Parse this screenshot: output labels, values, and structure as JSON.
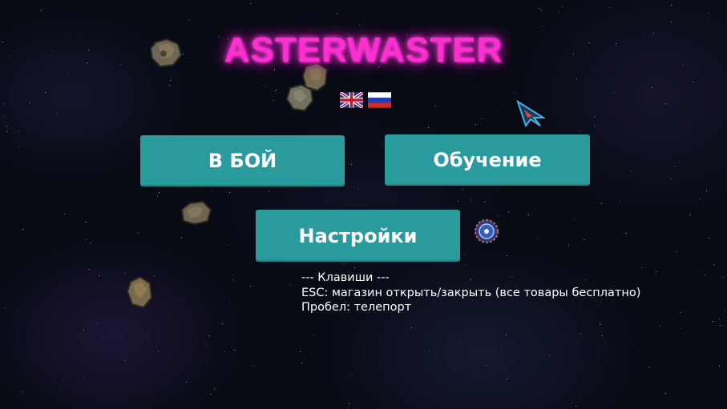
{
  "game": {
    "title": "ASTERWASTER",
    "title_color": "#ff2fcf",
    "button_color": "#2a9b9c"
  },
  "language_flags": [
    {
      "icon": "uk-flag-icon"
    },
    {
      "icon": "russia-flag-icon"
    }
  ],
  "menu": {
    "battle_label": "В БОЙ",
    "tutorial_label": "Обучение",
    "settings_label": "Настройки"
  },
  "controls_help": {
    "header": "--- Клавиши ---",
    "lines": [
      "ESC: магазин открыть/закрыть (все товары бесплатно)",
      "Пробел: телепорт"
    ]
  },
  "sprites": {
    "asteroid_icon": "asteroid-icon",
    "player_ship_icon": "player-ship-icon",
    "enemy_icon": "enemy-drone-icon"
  }
}
